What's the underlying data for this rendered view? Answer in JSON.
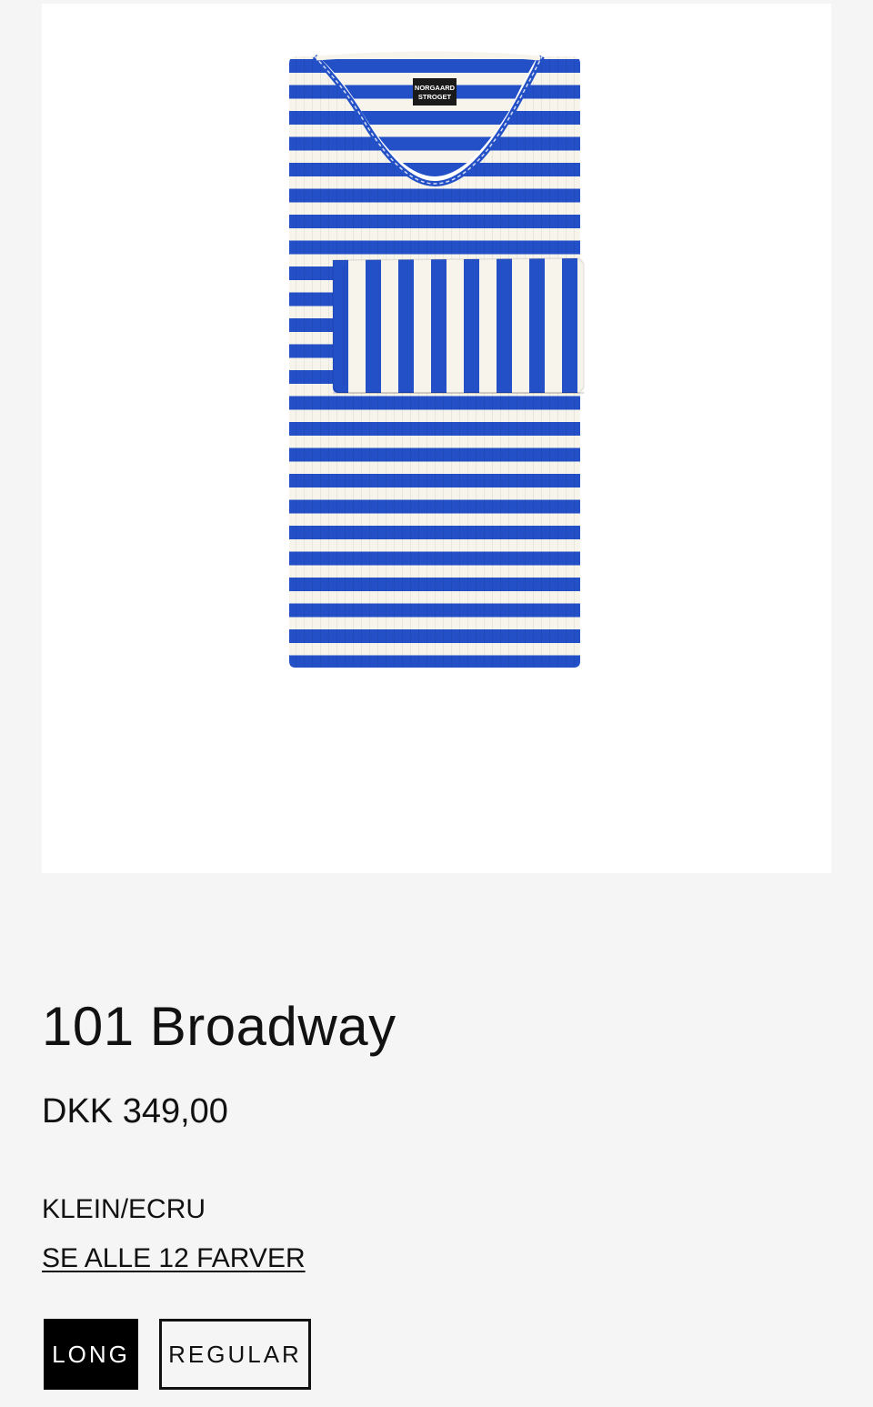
{
  "product": {
    "image_alt": "Striped long sleeve top",
    "brand_label": "NORGAARD STROGET",
    "title": "101 Broadway",
    "price": "DKK 349,00",
    "color_name": "KLEIN/ECRU",
    "see_all_colors": "SE ALLE 12 FARVER"
  },
  "fit_options": [
    {
      "label": "LONG",
      "selected": true
    },
    {
      "label": "REGULAR",
      "selected": false
    }
  ],
  "colors": {
    "stripe_blue": "#2350c6",
    "stripe_ecru": "#f7f4ec",
    "selected_bg": "#000000",
    "page_bg": "#f5f5f5"
  }
}
